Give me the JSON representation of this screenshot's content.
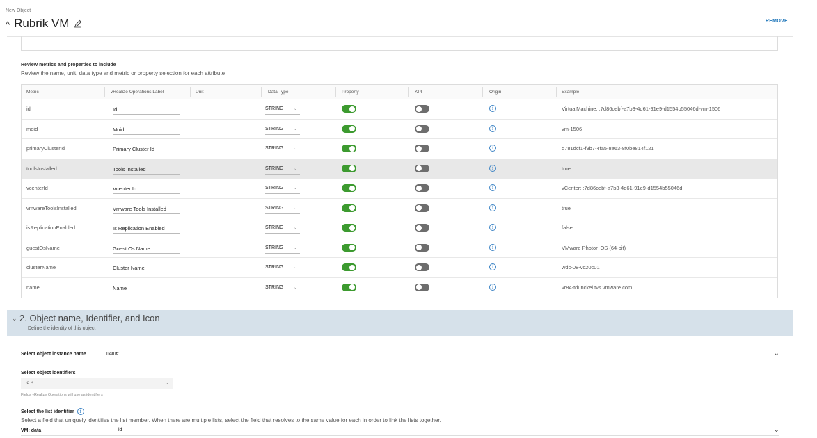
{
  "header": {
    "top_label": "New Object",
    "title": "Rubrik VM",
    "remove_label": "REMOVE"
  },
  "review": {
    "title": "Review metrics and properties to include",
    "subtitle": "Review the name, unit, data type and metric or property selection for each attribute"
  },
  "table": {
    "headers": [
      "Metric",
      "vRealize Operations Label",
      "Unit",
      "Data Type",
      "Property",
      "KPI",
      "Origin",
      "Example"
    ],
    "rows": [
      {
        "metric": "id",
        "label": "Id",
        "type": "STRING",
        "example": "VirtualMachine:::7d86cebf-a7b3-4d61-91e9-d1554b55046d-vm-1506"
      },
      {
        "metric": "moid",
        "label": "Moid",
        "type": "STRING",
        "example": "vm-1506"
      },
      {
        "metric": "primaryClusterId",
        "label": "Primary Cluster Id",
        "type": "STRING",
        "example": "d781dcf1-f9b7-4fa5-8a63-8f0be814f121"
      },
      {
        "metric": "toolsInstalled",
        "label": "Tools Installed",
        "type": "STRING",
        "example": "true"
      },
      {
        "metric": "vcenterId",
        "label": "Vcenter Id",
        "type": "STRING",
        "example": "vCenter:::7d86cebf-a7b3-4d61-91e9-d1554b55046d"
      },
      {
        "metric": "vmwareToolsInstalled",
        "label": "Vmware Tools Installed",
        "type": "STRING",
        "example": "true"
      },
      {
        "metric": "isReplicationEnabled",
        "label": "Is Replication Enabled",
        "type": "STRING",
        "example": "false"
      },
      {
        "metric": "guestOsName",
        "label": "Guest Os Name",
        "type": "STRING",
        "example": "VMware Photon OS (64-bit)"
      },
      {
        "metric": "clusterName",
        "label": "Cluster Name",
        "type": "STRING",
        "example": "wdc-08-vc20c01"
      },
      {
        "metric": "name",
        "label": "Name",
        "type": "STRING",
        "example": "vr84-tdunckel.tvs.vmware.com"
      }
    ]
  },
  "section2": {
    "title": "2. Object name, Identifier, and Icon",
    "subtitle": "Define the identity of this object"
  },
  "instance_name": {
    "label": "Select object instance name",
    "value": "name"
  },
  "identifiers": {
    "label": "Select object identifiers",
    "chip": "id",
    "help": "Fields vRealize Operations will use as identifiers"
  },
  "list_identifier": {
    "label": "Select the list identifier",
    "description": "Select a field that uniquely identifies the list member. When there are multiple lists, select the field that resolves to the same value for each in order to link the lists together.",
    "vm_label": "VM: data",
    "vm_value": "id"
  },
  "colors": {
    "accent": "#1a73b8",
    "toggle_on": "#3c9a2f",
    "toggle_off": "#6d6d6d",
    "section_bg": "#d6e1ea"
  }
}
